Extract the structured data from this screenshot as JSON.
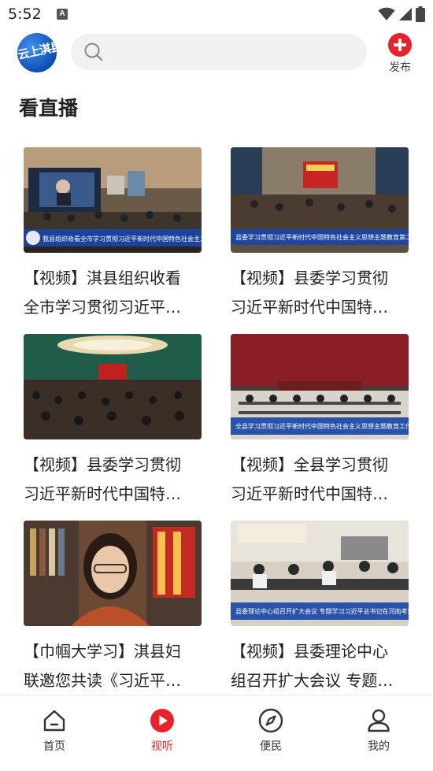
{
  "status_bar": {
    "time": "5:52",
    "notice_glyph": "A"
  },
  "header": {
    "logo_text": "云上淇县",
    "publish_label": "发布"
  },
  "page_title": "看直播",
  "videos": [
    {
      "line1": "【视频】淇县组织收看",
      "line2": "全市学习贯彻习近平…",
      "ticker": "我县组织收看全市学习贯彻习近平新时代中国特色社会主义思想主题教育动员会"
    },
    {
      "line1": "【视频】县委学习贯彻",
      "line2": "习近平新时代中国特…",
      "ticker": "县委学习贯彻习近平新时代中国特色社会主义思想主题教育第二期读书班集中研讨"
    },
    {
      "line1": "【视频】县委学习贯彻",
      "line2": "习近平新时代中国特…",
      "ticker": ""
    },
    {
      "line1": "【视频】全县学习贯彻",
      "line2": "习近平新时代中国特…",
      "ticker": "全县学习贯彻习近平新时代中国特色社会主义思想主题教育工作会议召开"
    },
    {
      "line1": "【巾帼大学习】淇县妇",
      "line2": "联邀您共读《习近平…",
      "ticker": ""
    },
    {
      "line1": "【视频】县委理论中心",
      "line2": "组召开扩大会议 专题…",
      "ticker": "县委理论中心组召开扩大会议 专题学习习近平总书记在河南考察时重要讲话精神"
    }
  ],
  "bottom_nav": [
    {
      "label": "首页",
      "icon": "home-icon"
    },
    {
      "label": "视听",
      "icon": "play-icon"
    },
    {
      "label": "便民",
      "icon": "compass-icon"
    },
    {
      "label": "我的",
      "icon": "user-icon"
    }
  ],
  "colors": {
    "accent": "#e8222a",
    "search_bg": "#f1f1f1"
  }
}
